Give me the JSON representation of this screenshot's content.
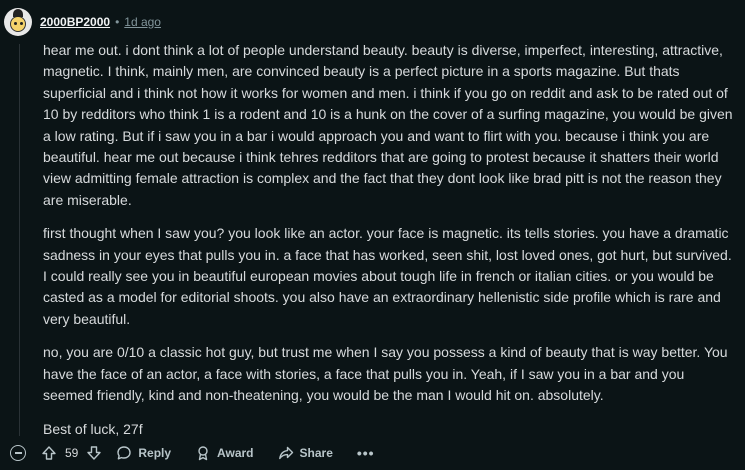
{
  "comment": {
    "author": "2000BP2000",
    "separator": "•",
    "time_ago": "1d ago",
    "paragraphs": [
      "hear me out. i dont think a lot of people understand beauty. beauty is diverse, imperfect, interesting, attractive, magnetic. I think, mainly men, are convinced beauty is a perfect picture in a sports magazine. But thats superficial and i think not how it works for women and men. i think if you go on reddit and ask to be rated out of 10 by redditors who think 1 is a rodent and 10 is a hunk on the cover of a surfing magazine, you would be given a low rating. But if i saw you in a bar i would approach you and want to flirt with you. because i think you are beautiful. hear me out because i think tehres redditors that are going to protest because it shatters their world view admitting female attraction is complex and the fact that they dont look like brad pitt is not the reason they are miserable.",
      "first thought when I saw you? you look like an actor. your face is magnetic. its tells stories. you have a dramatic sadness in your eyes that pulls you in. a face that has worked, seen shit, lost loved ones, got hurt, but survived. I could really see you in beautiful european movies about tough life in french or italian cities. or you would be casted as a model for editorial shoots. you also have an extraordinary hellenistic side profile which is rare and very beautiful.",
      "no, you are 0/10 a classic hot guy, but trust me when I say you possess a kind of beauty that is way better. You have the face of an actor, a face with stories, a face that pulls you in. Yeah, if I saw you in a bar and you seemed friendly, kind and non-theatening, you would be the man I would hit on. absolutely.",
      "Best of luck, 27f"
    ]
  },
  "actions": {
    "score": "59",
    "reply_label": "Reply",
    "award_label": "Award",
    "share_label": "Share",
    "more_label": "•••"
  },
  "icons": {
    "collapse": "minus-circle-icon",
    "upvote": "arrow-up-icon",
    "downvote": "arrow-down-icon",
    "reply": "speech-bubble-icon",
    "award": "award-icon",
    "share": "share-arrow-icon"
  },
  "colors": {
    "background": "#0b1416",
    "text": "#d7dadc",
    "muted": "#82959b",
    "action": "#b8c5c9"
  }
}
